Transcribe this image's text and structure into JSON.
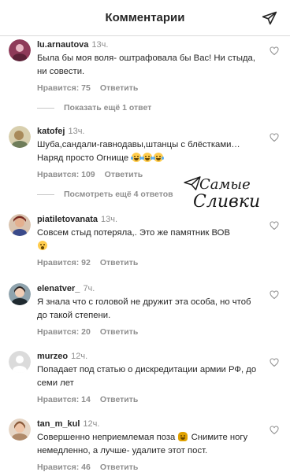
{
  "header": {
    "title": "Комментарии",
    "share_icon": "paper-plane-icon"
  },
  "comments": [
    {
      "user": "lu.arnautova",
      "time": "13ч.",
      "text": "Была бы моя воля- оштрафовала бы Вас! Ни стыда, ни совести.",
      "likes": "Нравится: 75",
      "reply": "Ответить",
      "avatar_color": "#8e3a59"
    },
    {
      "user": "katofej",
      "time": "13ч.",
      "text": "Шуба,сандали-гавнодавы,штанцы с блёстками…Наряд просто Огнище",
      "emoji": [
        "laughing-tears",
        "laughing-tears",
        "laughing-tears"
      ],
      "likes": "Нравится: 109",
      "reply": "Ответить",
      "avatar_color": "#b7a27a"
    },
    {
      "user": "piatiletovanata",
      "time": "13ч.",
      "text": "Совсем стыд потеряла,. Это же памятник ВОВ",
      "emoji": [
        "astonished-face"
      ],
      "likes": "Нравится: 92",
      "reply": "Ответить",
      "avatar_color": "#a04a3c"
    },
    {
      "user": "elenatver_",
      "time": "7ч.",
      "text": "Я знала что с головой не дружит эта особа, но чтоб до такой степени.",
      "likes": "Нравится: 20",
      "reply": "Ответить",
      "avatar_color": "#2e3a3f"
    },
    {
      "user": "murzeo",
      "time": "12ч.",
      "text": "Попадает под статью о дискредитации армии РФ, до семи лет",
      "likes": "Нравится: 14",
      "reply": "Ответить",
      "avatar_color": "#dbdbdb"
    },
    {
      "user": "tan_m_kul",
      "time": "12ч.",
      "text_before": "Совершенно неприемлемая поза",
      "text_after": "Снимите ногу немедленно, а лучше- удалите этот пост.",
      "emoji": [
        "person-facepalming"
      ],
      "likes": "Нравится: 46",
      "reply": "Ответить",
      "avatar_color": "#c9a27e"
    }
  ],
  "more_replies": [
    {
      "label": "Показать ещё 1 ответ"
    },
    {
      "label": "Посмотреть ещё 4 ответов"
    }
  ],
  "watermark": {
    "line1": "Самые",
    "line2": "Сливки"
  },
  "colors": {
    "text": "#262626",
    "secondary": "#8e8e8e",
    "divider": "#dbdbdb",
    "background": "#ffffff"
  }
}
